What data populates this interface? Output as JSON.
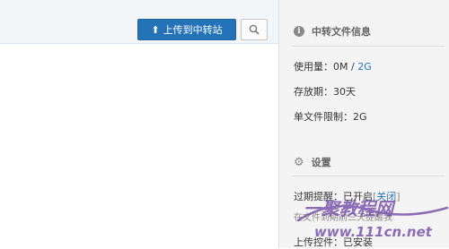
{
  "toolbar": {
    "upload_label": "上传到中转站",
    "upload_icon": "arrow-up-icon",
    "search_icon": "search-icon"
  },
  "sidebar": {
    "info_title": "中转文件信息",
    "usage_label": "使用量：",
    "usage_used": "0M",
    "usage_sep": " / ",
    "usage_total": "2G",
    "storage_label": "存放期：",
    "storage_value": "30天",
    "single_limit_label": "单文件限制：",
    "single_limit_value": "2G",
    "settings_title": "设置",
    "expiry_label": "过期提醒：",
    "expiry_value": "已开启",
    "expiry_toggle": "关闭",
    "expiry_desc": "在文件到期前三天提醒我",
    "upload_ctrl_label": "上传控件：",
    "upload_ctrl_value": "已安装"
  },
  "watermark": {
    "text": "一聚教程网",
    "url": "www.111cn.net"
  },
  "colors": {
    "accent": "#2472b7",
    "sidebar_bg": "#f4f4f4",
    "watermark": "#6a3fa0"
  }
}
